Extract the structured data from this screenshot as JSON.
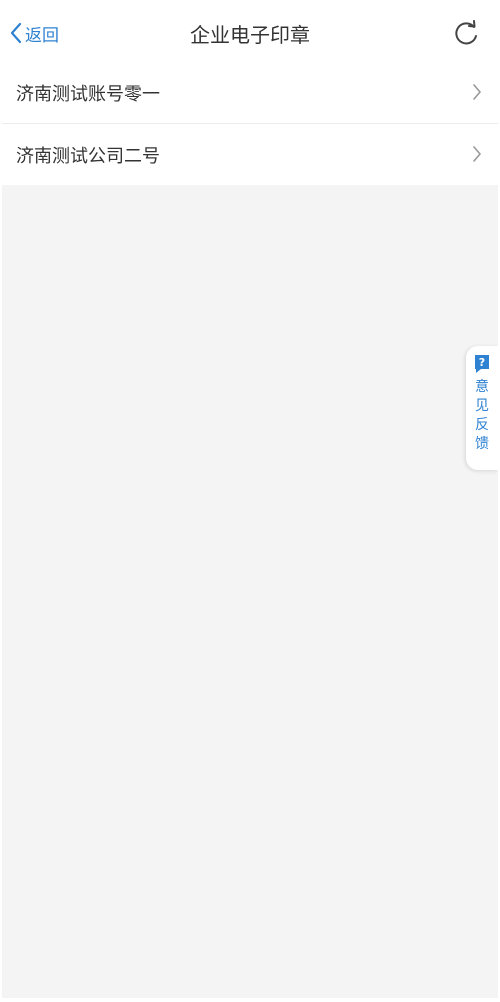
{
  "nav": {
    "back_label": "返回",
    "title": "企业电子印章"
  },
  "companies": [
    {
      "label": "济南测试账号零一"
    },
    {
      "label": "济南测试公司二号"
    }
  ],
  "feedback": {
    "label": "意见反馈"
  },
  "colors": {
    "accent": "#2f82d2",
    "background": "#f4f4f4",
    "text": "#333333"
  },
  "icons": {
    "back": "chevron-left-icon",
    "refresh": "refresh-icon",
    "row": "chevron-right-icon",
    "feedback": "question-icon"
  }
}
